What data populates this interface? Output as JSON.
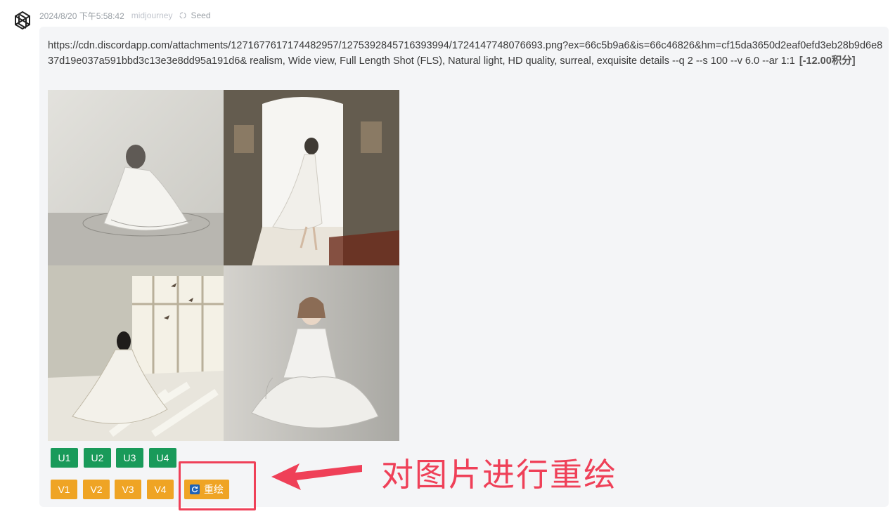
{
  "message": {
    "timestamp": "2024/8/20 下午5:58:42",
    "model": "midjourney",
    "seed_label": "Seed",
    "prompt_text": "https://cdn.discordapp.com/attachments/1271677617174482957/1275392845716393994/1724147748076693.png?ex=66c5b9a6&is=66c46826&hm=cf15da3650d2eaf0efd3eb28b9d6e837d19e037a591bbd3c13e3e8dd95a191d6& realism, Wide view, Full Length Shot (FLS), Natural light, HD quality, surreal, exquisite details  --q 2 --s 100  --v 6.0 --ar 1:1",
    "cost": "[-12.00积分]",
    "images": [
      {
        "name": "image-1-sitting-girl-grey-room"
      },
      {
        "name": "image-2-girl-walking-to-doorway"
      },
      {
        "name": "image-3-girl-by-window-birds"
      },
      {
        "name": "image-4-girl-seated-white-dress"
      }
    ],
    "upscale_buttons": [
      "U1",
      "U2",
      "U3",
      "U4"
    ],
    "variation_buttons": [
      "V1",
      "V2",
      "V3",
      "V4"
    ],
    "redraw_label": "重绘"
  },
  "annotation": {
    "text": "对图片进行重绘",
    "color": "#ef4058"
  },
  "colors": {
    "upscale": "#199a5a",
    "variation": "#efa424",
    "bubble": "#f4f5f7"
  },
  "icons": [
    "openai-logo-icon",
    "seed-icon",
    "refresh-icon",
    "arrow-icon"
  ]
}
